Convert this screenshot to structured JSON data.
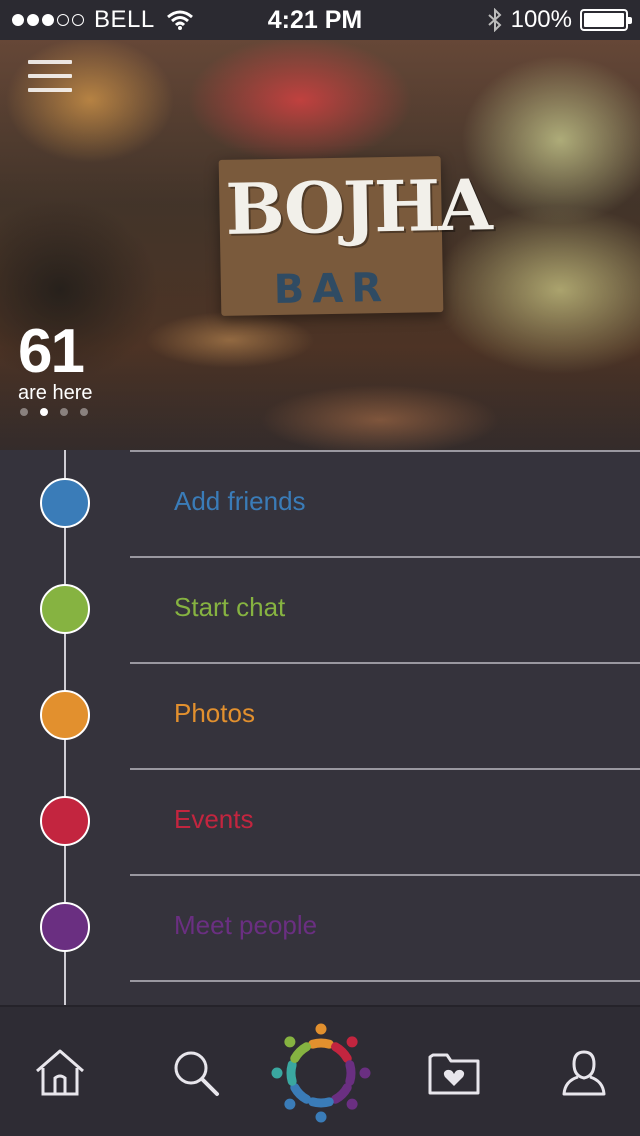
{
  "status_bar": {
    "carrier": "BELL",
    "time": "4:21 PM",
    "battery_label": "100%",
    "battery_level": 1.0,
    "signal_strength": 3,
    "signal_max": 5
  },
  "venue": {
    "logo_title": "BOJHA",
    "logo_sub": "BAR",
    "count": "61",
    "count_label": "are here",
    "page_count": 4,
    "active_page": 1
  },
  "menu": {
    "items": [
      {
        "label": "Add friends",
        "color": "#3a7cb8"
      },
      {
        "label": "Start chat",
        "color": "#86b341"
      },
      {
        "label": "Photos",
        "color": "#e2902e"
      },
      {
        "label": "Events",
        "color": "#c3253f"
      },
      {
        "label": "Meet people",
        "color": "#6a2f81"
      }
    ]
  },
  "tab_bar": {
    "tabs": [
      {
        "icon": "home-icon"
      },
      {
        "icon": "search-icon"
      },
      {
        "icon": "community-ring-icon"
      },
      {
        "icon": "favorites-folder-icon"
      },
      {
        "icon": "profile-icon"
      }
    ]
  },
  "colors": {
    "background": "#35333c",
    "tab_bar": "#2e2c34",
    "status_bar": "#2b2a31"
  }
}
